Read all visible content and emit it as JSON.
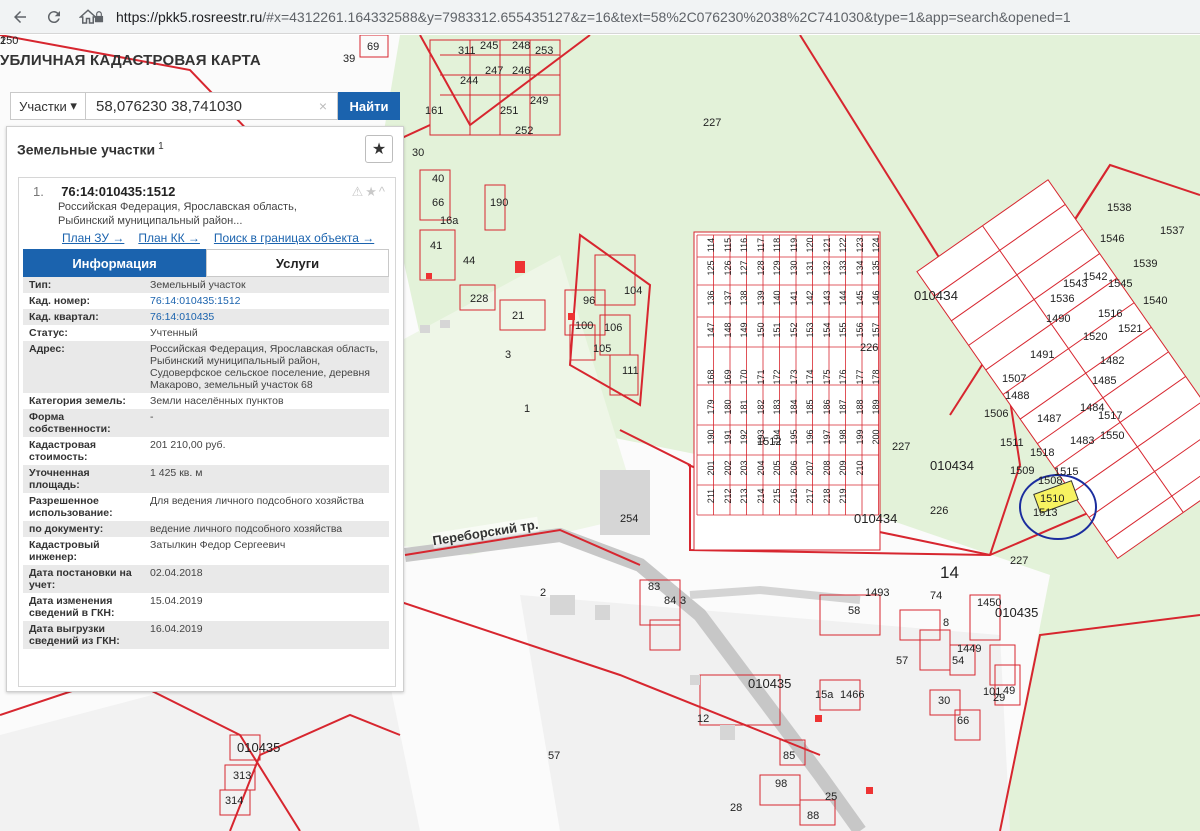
{
  "browser": {
    "url_domain": "https://pkk5.rosreestr.ru",
    "url_rest": "/#x=4312261.164332588&y=7983312.655435127&z=16&text=58%2C076230%2038%2C741030&type=1&app=search&opened=1"
  },
  "app": {
    "title": "УБЛИЧНАЯ КАДАСТРОВАЯ КАРТА"
  },
  "search": {
    "type_label": "Участки",
    "type_arrow": "▾",
    "query": "58,076230 38,741030",
    "clear": "×",
    "button": "Найти"
  },
  "panel": {
    "title": "Земельные участки",
    "count": "1",
    "star": "★"
  },
  "result": {
    "num": "1.",
    "cad_number": "76:14:010435:1512",
    "addr_line1": "Российская Федерация, Ярославская область,",
    "addr_line2": "Рыбинский муниципальный район...",
    "icons": "⚠★^",
    "links": [
      "План ЗУ →",
      "План КК →",
      "Поиск в границах объекта →"
    ],
    "tabs": [
      "Информация",
      "Услуги"
    ],
    "rows": [
      {
        "k": "Тип:",
        "v": "Земельный участок"
      },
      {
        "k": "Кад. номер:",
        "v": "76:14:010435:1512"
      },
      {
        "k": "Кад. квартал:",
        "v": "76:14:010435"
      },
      {
        "k": "Статус:",
        "v": "Учтенный"
      },
      {
        "k": "Адрес:",
        "v": "Российская Федерация, Ярославская область, Рыбинский муниципальный район, Судоверфское сельское поселение, деревня Макарово, земельный участок 68"
      },
      {
        "k": "Категория земель:",
        "v": "Земли населённых пунктов"
      },
      {
        "k": "Форма собственности:",
        "v": "-"
      },
      {
        "k": "Кадастровая стоимость:",
        "v": "201 210,00 руб."
      },
      {
        "k": "Уточненная площадь:",
        "v": "1 425 кв. м"
      },
      {
        "k": "Разрешенное использование:",
        "v": "Для ведения личного подсобного хозяйства"
      },
      {
        "k": "по документу:",
        "v": "ведение личного подсобного хозяйства"
      },
      {
        "k": "Кадастровый инженер:",
        "v": "Затылкин Федор Сергеевич"
      },
      {
        "k": "Дата постановки на учет:",
        "v": "02.04.2018"
      },
      {
        "k": "Дата изменения сведений в ГКН:",
        "v": "15.04.2019"
      },
      {
        "k": "Дата выгрузки сведений из ГКН:",
        "v": "16.04.2019"
      }
    ]
  },
  "map": {
    "road": "Переборский тр.",
    "labels": [
      "39",
      "69",
      "161",
      "30",
      "40",
      "66",
      "16а",
      "190",
      "41",
      "44",
      "228",
      "21",
      "96",
      "104",
      "106",
      "100",
      "105",
      "111",
      "3",
      "1",
      "2",
      "84",
      "83",
      "3",
      "12",
      "57",
      "28",
      "25",
      "98",
      "88",
      "85",
      "15а",
      "1466",
      "010435",
      "57",
      "54",
      "1449",
      "101",
      "49",
      "29",
      "30",
      "66",
      "1493",
      "58",
      "8",
      "74",
      "1450",
      "010435",
      "14",
      "227",
      "227",
      "227",
      "0104З4",
      "0104З4",
      "226",
      "226",
      "010434",
      "1512",
      "1510",
      "1513",
      "1508",
      "1509",
      "1518",
      "1511",
      "1506",
      "1515",
      "1483",
      "1487",
      "1488",
      "1507",
      "1484",
      "1485",
      "1517",
      "1550",
      "1491",
      "1490",
      "1520",
      "1482",
      "1536",
      "1543",
      "1516",
      "1521",
      "1540",
      "1539",
      "1542",
      "1546",
      "1538",
      "1537",
      "1545",
      "010435",
      "313",
      "314",
      "311",
      "245",
      "244",
      "247",
      "246",
      "248",
      "249",
      "251",
      "252",
      "253",
      "254",
      "250",
      "1"
    ],
    "grid_rows": [
      [
        "114",
        "115",
        "116",
        "117",
        "118",
        "119",
        "120",
        "121",
        "122",
        "123",
        "124"
      ],
      [
        "125",
        "126",
        "127",
        "128",
        "129",
        "130",
        "131",
        "132",
        "133",
        "134",
        "135"
      ],
      [
        "136",
        "137",
        "138",
        "139",
        "140",
        "141",
        "142",
        "143",
        "144",
        "145",
        "146"
      ],
      [
        "147",
        "148",
        "149",
        "150",
        "151",
        "152",
        "153",
        "154",
        "155",
        "156",
        "157"
      ],
      [
        "168",
        "169",
        "170",
        "171",
        "172",
        "173",
        "174",
        "175",
        "176",
        "177",
        "178"
      ],
      [
        "179",
        "180",
        "181",
        "182",
        "183",
        "184",
        "185",
        "186",
        "187",
        "188",
        "189"
      ],
      [
        "190",
        "191",
        "192",
        "193",
        "194",
        "195",
        "196",
        "197",
        "198",
        "199",
        "200"
      ],
      [
        "201",
        "202",
        "203",
        "204",
        "205",
        "206",
        "207",
        "208",
        "209",
        "210"
      ],
      [
        "211",
        "212",
        "213",
        "214",
        "215",
        "216",
        "217",
        "218",
        "219"
      ]
    ]
  }
}
